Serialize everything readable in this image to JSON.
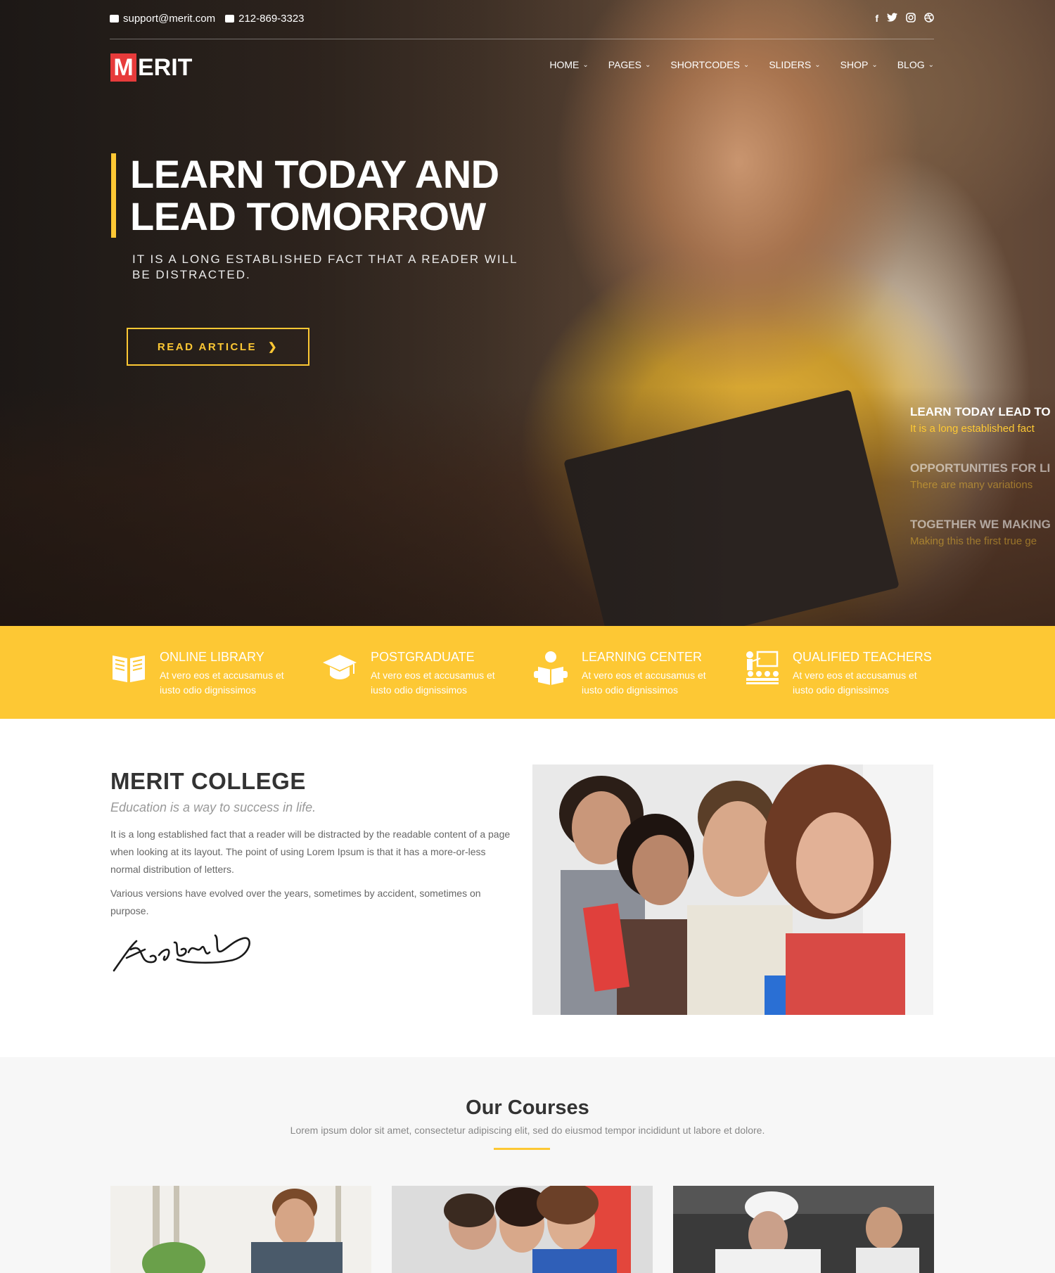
{
  "topbar": {
    "email": "support@merit.com",
    "phone": "212-869-3323",
    "social_icons": [
      "facebook-icon",
      "twitter-icon",
      "instagram-icon",
      "dribbble-icon"
    ]
  },
  "logo": {
    "initial": "M",
    "rest": "ERIT"
  },
  "nav": [
    {
      "label": "HOME"
    },
    {
      "label": "PAGES"
    },
    {
      "label": "SHORTCODES"
    },
    {
      "label": "SLIDERS"
    },
    {
      "label": "SHOP"
    },
    {
      "label": "BLOG"
    }
  ],
  "hero": {
    "headline_line1": "LEARN TODAY AND",
    "headline_line2": "LEAD TOMORROW",
    "subheading": "IT IS A LONG ESTABLISHED FACT THAT A READER WILL BE DISTRACTED.",
    "button_label": "READ ARTICLE",
    "slides": [
      {
        "title": "LEARN TODAY LEAD TO",
        "desc": "It is a long established fact"
      },
      {
        "title": "OPPORTUNITIES FOR LI",
        "desc": "There are many variations"
      },
      {
        "title": "TOGETHER WE MAKING",
        "desc": "Making this the first true ge"
      }
    ]
  },
  "features": [
    {
      "title": "ONLINE LIBRARY",
      "desc": "At vero eos et accusamus et iusto odio dignissimos",
      "icon": "book-icon"
    },
    {
      "title": "POSTGRADUATE",
      "desc": "At vero eos et accusamus et iusto odio dignissimos",
      "icon": "graduation-cap-icon"
    },
    {
      "title": "LEARNING CENTER",
      "desc": "At vero eos et accusamus et iusto odio dignissimos",
      "icon": "reader-icon"
    },
    {
      "title": "QUALIFIED TEACHERS",
      "desc": "At vero eos et accusamus et iusto odio dignissimos",
      "icon": "teacher-icon"
    }
  ],
  "about": {
    "title": "MERIT COLLEGE",
    "tagline": "Education is a way to success in life.",
    "paragraph1": "It is a long established fact that a reader will be distracted by the readable content of a page when looking at its layout. The point of using Lorem Ipsum is that it has a more-or-less normal distribution of letters.",
    "paragraph2": "Various versions have evolved over the years, sometimes by accident, sometimes on purpose."
  },
  "courses": {
    "title": "Our Courses",
    "subtitle": "Lorem ipsum dolor sit amet, consectetur adipiscing elit, sed do eiusmod tempor incididunt ut labore et dolore."
  },
  "colors": {
    "accent": "#fdc834",
    "brand_red": "#e73b3b"
  }
}
